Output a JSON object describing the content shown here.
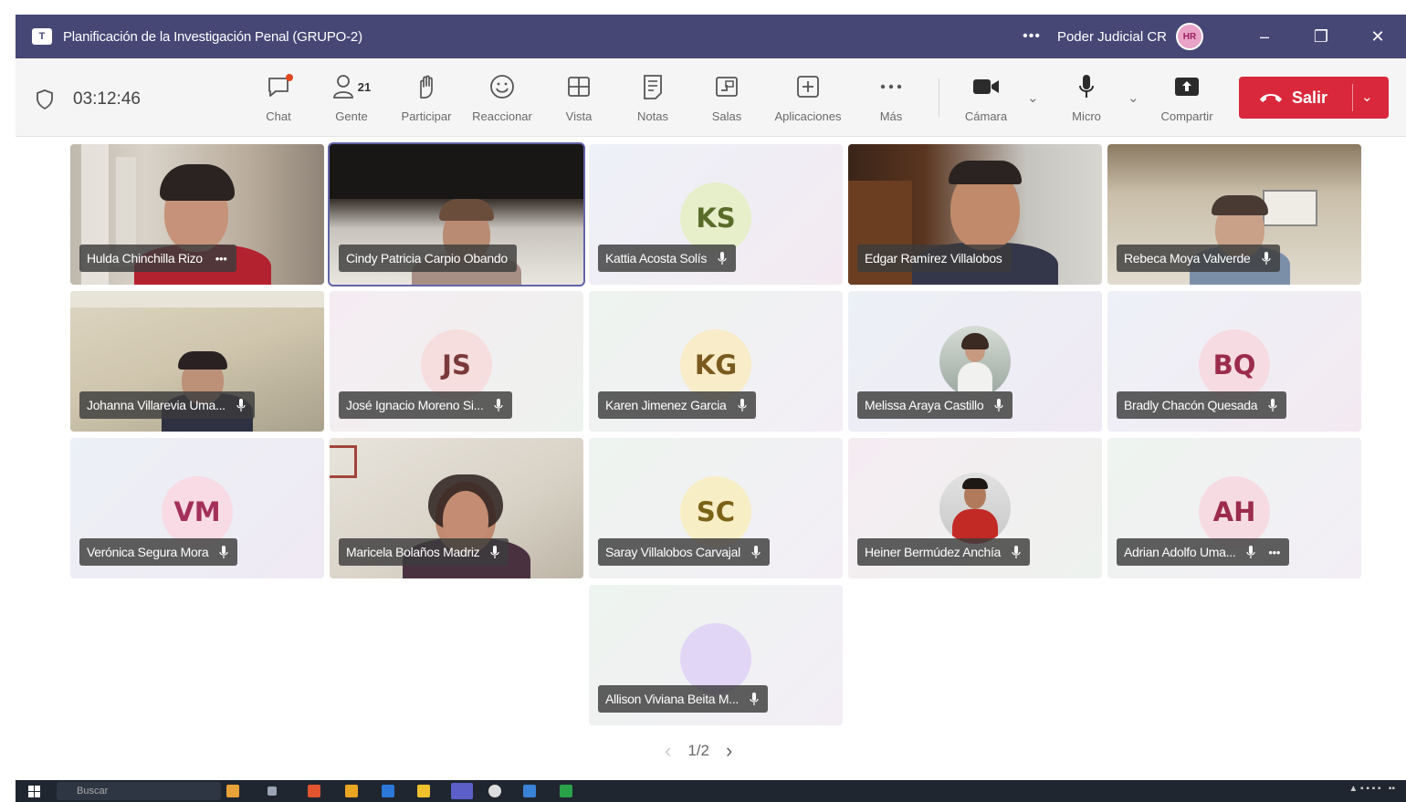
{
  "window": {
    "title": "Planificación de la Investigación Penal (GRUPO-2)",
    "more": "•••",
    "org": "Poder Judicial CR",
    "avatar_initials": "HR",
    "minimize": "–",
    "restore": "❐",
    "close": "✕"
  },
  "toolbar": {
    "timer": "03:12:46",
    "buttons": [
      {
        "label": "Chat",
        "icon": "chat-icon"
      },
      {
        "label": "Gente",
        "icon": "people-icon",
        "count": "21"
      },
      {
        "label": "Participar",
        "icon": "raise-hand-icon"
      },
      {
        "label": "Reaccionar",
        "icon": "emoji-icon"
      },
      {
        "label": "Vista",
        "icon": "grid-view-icon"
      },
      {
        "label": "Notas",
        "icon": "notes-icon"
      },
      {
        "label": "Salas",
        "icon": "breakout-rooms-icon"
      },
      {
        "label": "Aplicaciones",
        "icon": "add-apps-icon"
      },
      {
        "label": "Más",
        "icon": "more-icon"
      },
      {
        "label": "Cámara",
        "icon": "camera-icon"
      },
      {
        "label": "Micro",
        "icon": "microphone-icon"
      },
      {
        "label": "Compartir",
        "icon": "share-icon"
      }
    ],
    "leave_label": "Salir"
  },
  "participants": [
    {
      "name": "Hulda Chinchilla Rizo",
      "more": "•••",
      "type": "video"
    },
    {
      "name": "Cindy Patricia Carpio Obando",
      "type": "video"
    },
    {
      "name": "Kattia Acosta Solís",
      "initials": "KS",
      "type": "avatar",
      "color": "#e6efc9",
      "text_color": "#5a6b2a"
    },
    {
      "name": "Edgar Ramírez Villalobos",
      "type": "video"
    },
    {
      "name": "Rebeca Moya Valverde",
      "type": "video"
    },
    {
      "name": "Johanna Villarevia Uma...",
      "type": "video"
    },
    {
      "name": "José Ignacio Moreno Si...",
      "initials": "JS",
      "type": "avatar",
      "color": "#f6dede",
      "text_color": "#7a3a3a"
    },
    {
      "name": "Karen Jimenez Garcia",
      "initials": "KG",
      "type": "avatar",
      "color": "#f8ecc9",
      "text_color": "#7a5a1e"
    },
    {
      "name": "Melissa Araya Castillo",
      "type": "photo"
    },
    {
      "name": "Bradly Chacón Quesada",
      "initials": "BQ",
      "type": "avatar",
      "color": "#f7dbe3",
      "text_color": "#9b2c4d"
    },
    {
      "name": "Verónica Segura Mora",
      "initials": "VM",
      "type": "avatar",
      "color": "#f8dbe5",
      "text_color": "#a3305a"
    },
    {
      "name": "Maricela Bolaños Madriz",
      "type": "video"
    },
    {
      "name": "Saray Villalobos Carvajal",
      "initials": "SC",
      "type": "avatar",
      "color": "#f8eec6",
      "text_color": "#7a6217"
    },
    {
      "name": "Heiner Bermúdez Anchía",
      "type": "photo"
    },
    {
      "name": "Adrian Adolfo Uma...",
      "initials": "AH",
      "type": "avatar",
      "color": "#f7dbe3",
      "text_color": "#9b2c4d",
      "more": "•••"
    },
    {
      "name": "Allison Viviana Beita M...",
      "initials": "",
      "type": "avatar",
      "color": "#e2d6f6",
      "text_color": "#5a3a8a"
    }
  ],
  "pager": {
    "prev": "‹",
    "page": "1/2",
    "next": "›"
  },
  "taskbar": {
    "search_placeholder": "Buscar"
  }
}
